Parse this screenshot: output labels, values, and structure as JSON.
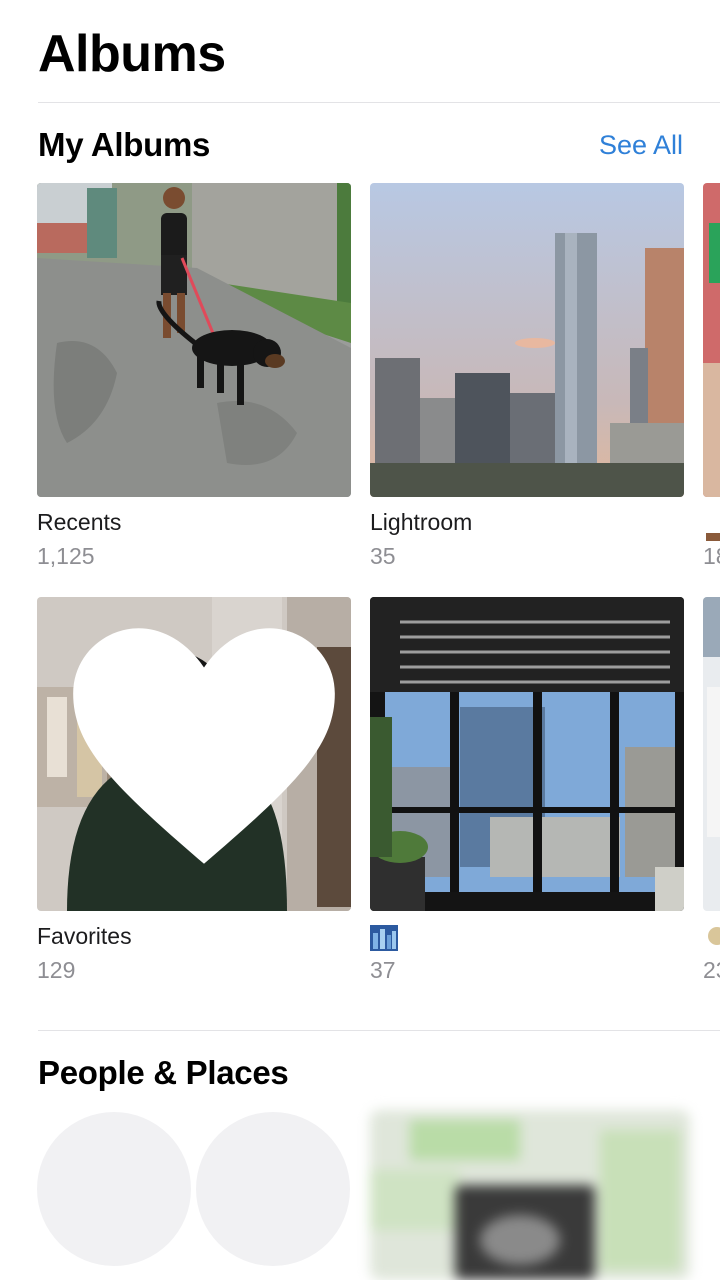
{
  "header": {
    "title": "Albums"
  },
  "my_albums": {
    "title": "My Albums",
    "see_all_label": "See All",
    "albums": [
      {
        "name": "Recents",
        "count": "1,125"
      },
      {
        "name": "Lightroom",
        "count": "35"
      },
      {
        "name": "Favorites",
        "count": "129"
      },
      {
        "name": "",
        "count": "37",
        "icon": "city-thumbnail-icon"
      }
    ],
    "peek_counts": [
      "18",
      "23"
    ]
  },
  "people_places": {
    "title": "People & Places"
  },
  "colors": {
    "accent": "#2f80d8",
    "secondary_text": "#8e8e93",
    "divider": "#e3e3e6"
  }
}
